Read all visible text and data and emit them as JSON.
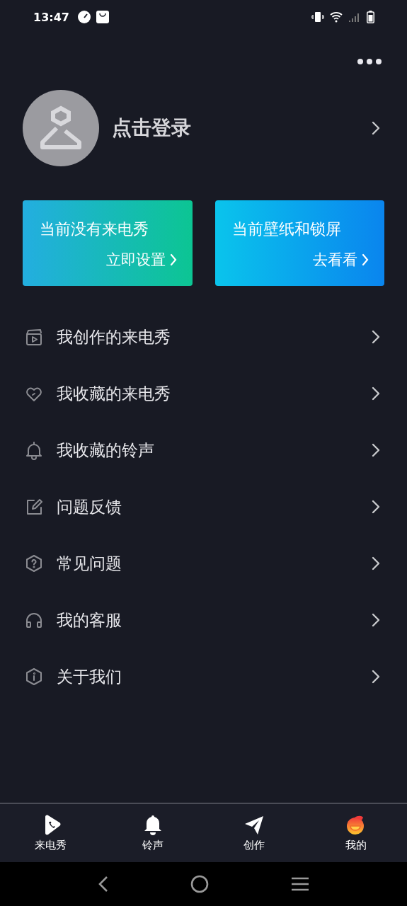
{
  "status_bar": {
    "time": "13:47"
  },
  "profile": {
    "login_label": "点击登录"
  },
  "cards": [
    {
      "title": "当前没有来电秀",
      "action": "立即设置",
      "kind": "green"
    },
    {
      "title": "当前壁纸和锁屏",
      "action": "去看看",
      "kind": "blue"
    }
  ],
  "menu": [
    {
      "label": "我创作的来电秀",
      "kind": "clapper"
    },
    {
      "label": "我收藏的来电秀",
      "kind": "heart"
    },
    {
      "label": "我收藏的铃声",
      "kind": "bell"
    },
    {
      "label": "问题反馈",
      "kind": "edit"
    },
    {
      "label": "常见问题",
      "kind": "question"
    },
    {
      "label": "我的客服",
      "kind": "headset"
    },
    {
      "label": "关于我们",
      "kind": "info"
    }
  ],
  "tabs": [
    {
      "label": "来电秀",
      "kind": "call",
      "selected": false
    },
    {
      "label": "铃声",
      "kind": "bell",
      "selected": false
    },
    {
      "label": "创作",
      "kind": "plane",
      "selected": false
    },
    {
      "label": "我的",
      "kind": "me",
      "selected": true
    }
  ]
}
